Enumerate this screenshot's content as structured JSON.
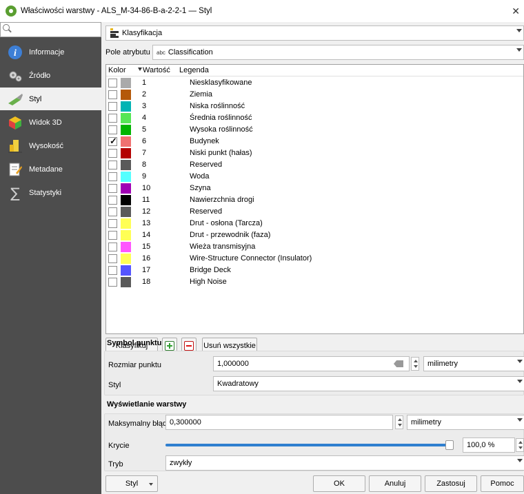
{
  "window": {
    "title": "Właściwości warstwy - ALS_M-34-86-B-a-2-2-1 — Styl",
    "close": "✕"
  },
  "sidebar": {
    "search_placeholder": "",
    "items": [
      {
        "label": "Informacje",
        "icon": "info-icon"
      },
      {
        "label": "Źródło",
        "icon": "source-icon"
      },
      {
        "label": "Styl",
        "icon": "paintbrush-icon"
      },
      {
        "label": "Widok 3D",
        "icon": "cube-3d-icon"
      },
      {
        "label": "Wysokość",
        "icon": "elevation-icon"
      },
      {
        "label": "Metadane",
        "icon": "metadata-icon"
      },
      {
        "label": "Statystyki",
        "icon": "sigma-icon"
      }
    ],
    "active": "Styl"
  },
  "renderer": {
    "label": "Klasyfikacja"
  },
  "attribute": {
    "label": "Pole atrybutu",
    "type_tag": "abc",
    "value": "Classification"
  },
  "table": {
    "headers": {
      "color": "Kolor",
      "value": "Wartość",
      "legend": "Legenda"
    },
    "rows": [
      {
        "value": "1",
        "legend": "Niesklasyfikowane",
        "color": "#aaaaaa",
        "checked": false
      },
      {
        "value": "2",
        "legend": "Ziemia",
        "color": "#b4590a",
        "checked": false
      },
      {
        "value": "3",
        "legend": "Niska roślinność",
        "color": "#00b4b4",
        "checked": false
      },
      {
        "value": "4",
        "legend": "Średnia roślinność",
        "color": "#55e655",
        "checked": false
      },
      {
        "value": "5",
        "legend": "Wysoka roślinność",
        "color": "#00b400",
        "checked": false
      },
      {
        "value": "6",
        "legend": "Budynek",
        "color": "#f07070",
        "checked": true
      },
      {
        "value": "7",
        "legend": "Niski punkt (hałas)",
        "color": "#b40000",
        "checked": false
      },
      {
        "value": "8",
        "legend": "Reserved",
        "color": "#5a5a5a",
        "checked": false
      },
      {
        "value": "9",
        "legend": "Woda",
        "color": "#55ffff",
        "checked": false
      },
      {
        "value": "10",
        "legend": "Szyna",
        "color": "#a000b4",
        "checked": false
      },
      {
        "value": "11",
        "legend": "Nawierzchnia drogi",
        "color": "#000000",
        "checked": false
      },
      {
        "value": "12",
        "legend": "Reserved",
        "color": "#5a5a5a",
        "checked": false
      },
      {
        "value": "13",
        "legend": "Drut - osłona (Tarcza)",
        "color": "#ffff55",
        "checked": false
      },
      {
        "value": "14",
        "legend": "Drut - przewodnik (faza)",
        "color": "#ffff55",
        "checked": false
      },
      {
        "value": "15",
        "legend": "Wieża transmisyjna",
        "color": "#ff55ff",
        "checked": false
      },
      {
        "value": "16",
        "legend": "Wire-Structure Connector (Insulator)",
        "color": "#ffff55",
        "checked": false
      },
      {
        "value": "17",
        "legend": "Bridge Deck",
        "color": "#5555ff",
        "checked": false
      },
      {
        "value": "18",
        "legend": "High Noise",
        "color": "#5a5a5a",
        "checked": false
      }
    ]
  },
  "buttons": {
    "classify": "Klasyfikuj",
    "add_icon": "plus-icon",
    "remove_icon": "minus-icon",
    "remove_all": "Usuń wszystkie"
  },
  "point_symbol": {
    "title": "Symbol punktu",
    "size_label": "Rozmiar punktu",
    "size_value": "1,000000",
    "size_unit": "milimetry",
    "style_label": "Styl",
    "style_value": "Kwadratowy"
  },
  "layer_rendering": {
    "title": "Wyświetlanie warstwy",
    "max_error_label": "Maksymalny błąd",
    "max_error_value": "0,300000",
    "max_error_unit": "milimetry",
    "opacity_label": "Krycie",
    "opacity_value": "100,0 %",
    "opacity_fraction": 1.0,
    "blend_label": "Tryb",
    "blend_value": "zwykły"
  },
  "bottom": {
    "style_menu": "Styl",
    "ok": "OK",
    "cancel": "Anuluj",
    "apply": "Zastosuj",
    "help": "Pomoc"
  },
  "colors": {
    "sidebar_bg": "#4d4d4d",
    "slider_accent": "#2f7fcf"
  }
}
